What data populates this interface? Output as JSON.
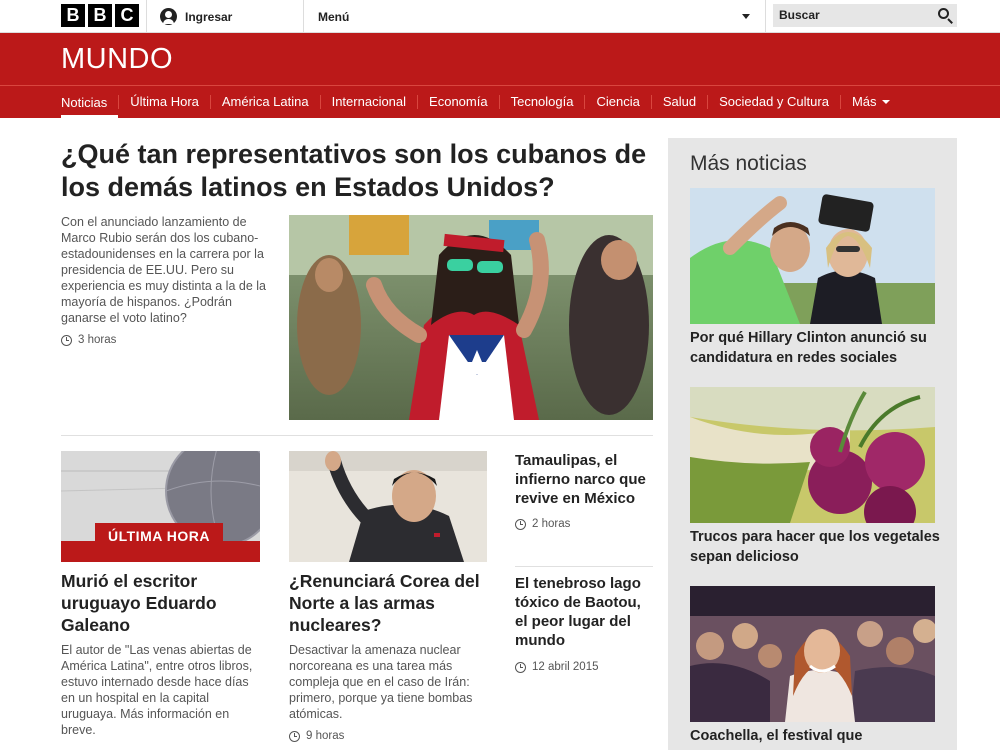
{
  "topbar": {
    "logo_letters": [
      "B",
      "B",
      "C"
    ],
    "signin_label": "Ingresar",
    "menu_label": "Menú",
    "search_placeholder": "Buscar"
  },
  "masthead": {
    "title": "MUNDO"
  },
  "nav": {
    "items": [
      "Noticias",
      "Última Hora",
      "América Latina",
      "Internacional",
      "Economía",
      "Tecnología",
      "Ciencia",
      "Salud",
      "Sociedad y Cultura",
      "Más"
    ],
    "active": "Noticias"
  },
  "lead": {
    "title": "¿Qué tan representativos son los cubanos de los demás latinos en Estados Unidos?",
    "summary": "Con el anunciado lanzamiento de Marco Rubio serán dos los cubano-estadounidenses en la carrera por la presidencia de EE.UU. Pero su experiencia es muy distinta a la de la mayoría de hispanos. ¿Podrán ganarse el voto latino?",
    "time": "3 horas"
  },
  "stories": [
    {
      "badge": "ÚLTIMA HORA",
      "title": "Murió el escritor uruguayo Eduardo Galeano",
      "summary": "El autor de \"Las venas abiertas de América Latina\", entre otros libros, estuvo internado desde hace días en un hospital en la capital uruguaya. Más información en breve."
    },
    {
      "title": "¿Renunciará Corea del Norte a las armas nucleares?",
      "summary": "Desactivar la amenaza nuclear norcoreana es una tarea más compleja que en el caso de Irán: primero, porque ya tiene bombas atómicas.",
      "time": "9 horas"
    },
    {
      "title": "Tamaulipas, el infierno narco que revive en México",
      "time": "2 horas"
    },
    {
      "title": "El tenebroso lago tóxico de Baotou, el peor lugar del mundo",
      "time": "12 abril 2015"
    }
  ],
  "sidebar": {
    "heading": "Más noticias",
    "items": [
      {
        "title": "Por qué Hillary Clinton anunció su candidatura en redes sociales"
      },
      {
        "title": "Trucos para hacer que los vegetales sepan delicioso"
      },
      {
        "title": "Coachella, el festival que"
      }
    ]
  },
  "colors": {
    "brand_red": "#bb1919",
    "sidebar_bg": "#e6e6e6"
  }
}
